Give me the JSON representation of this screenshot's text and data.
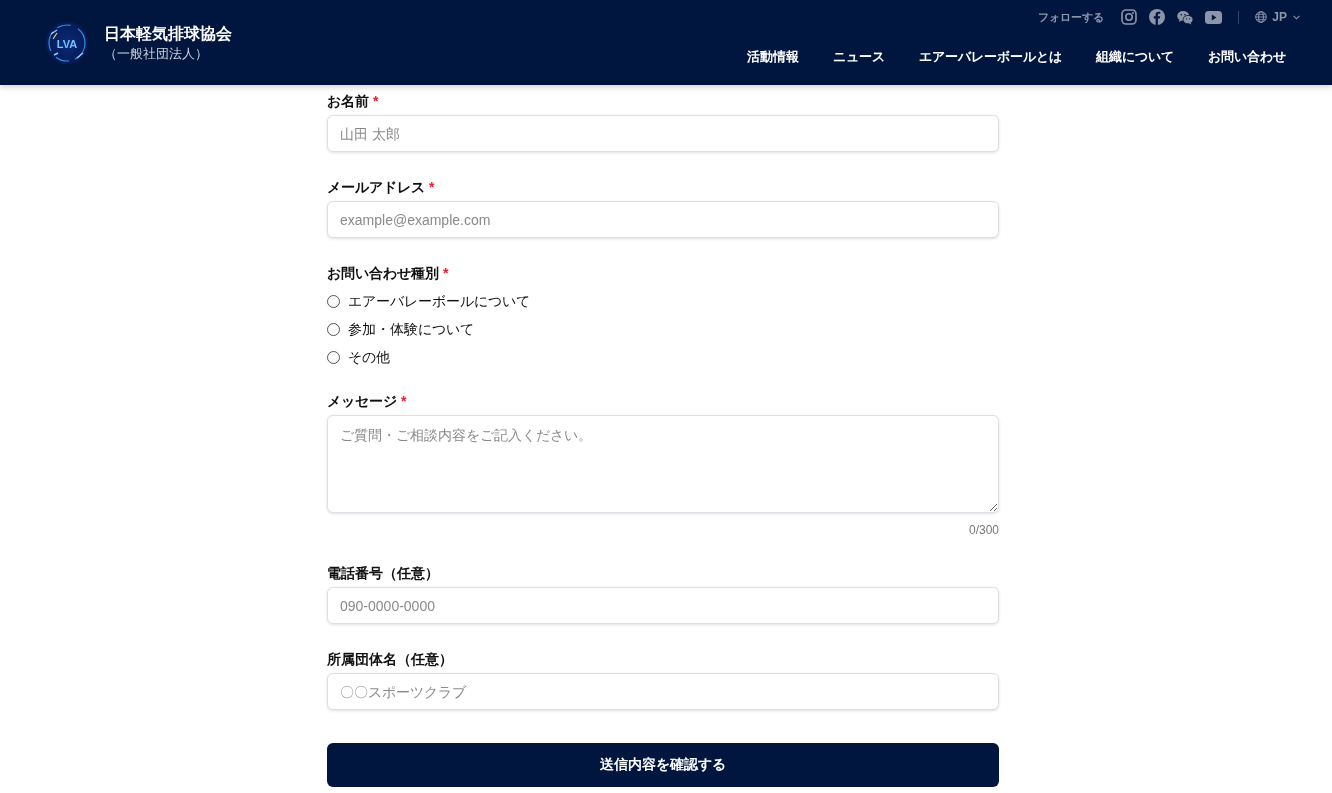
{
  "header": {
    "logo_mark": "LVA",
    "title": "日本軽気排球協会",
    "subtitle": "（一般社団法人）",
    "follow_label": "フォローする",
    "language": "JP",
    "nav": [
      {
        "label": "活動情報"
      },
      {
        "label": "ニュース"
      },
      {
        "label": "エアーバレーボールとは"
      },
      {
        "label": "組織について"
      },
      {
        "label": "お問い合わせ"
      }
    ]
  },
  "form": {
    "fields": [
      {
        "kind": "input",
        "label": "お名前",
        "required_mark": "*",
        "placeholder": "山田 太郎"
      },
      {
        "kind": "input",
        "label": "メールアドレス",
        "required_mark": "*",
        "placeholder": "example@example.com"
      },
      {
        "kind": "radio_group",
        "label": "お問い合わせ種別",
        "required_mark": "*",
        "options": [
          {
            "label": "エアーバレーボールについて",
            "selected": false
          },
          {
            "label": "参加・体験について",
            "selected": false
          },
          {
            "label": "その他",
            "selected": false
          }
        ]
      },
      {
        "kind": "textarea",
        "label": "メッセージ",
        "required_mark": "*",
        "placeholder": "ご質問・ご相談内容をご記入ください。",
        "counter": "0/300"
      },
      {
        "kind": "input",
        "label": "電話番号（任意）",
        "placeholder": "090-0000-0000"
      },
      {
        "kind": "input",
        "label": "所属団体名（任意）",
        "placeholder": "〇〇スポーツクラブ"
      }
    ],
    "submit_label": "送信内容を確認する"
  }
}
